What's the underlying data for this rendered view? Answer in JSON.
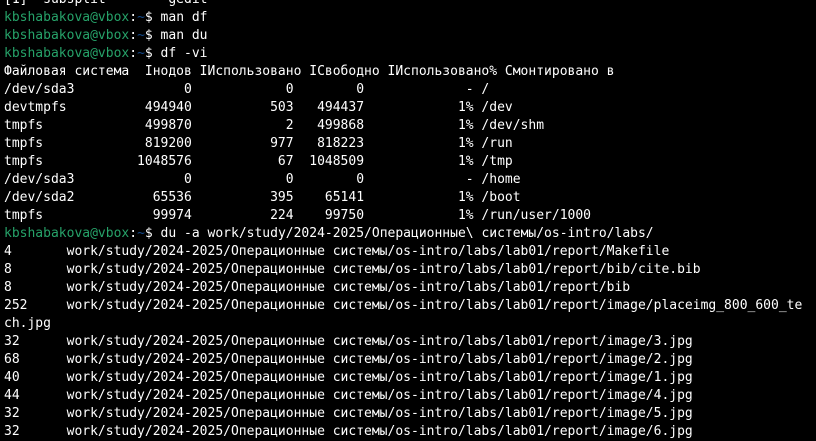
{
  "colors": {
    "background": "#000000",
    "foreground": "#ffffff",
    "prompt_user": "#26a269",
    "prompt_path": "#12488b"
  },
  "prompt": {
    "user_host": "kbshabakova@vbox",
    "colon": ":",
    "path": "~",
    "dollar": "$ "
  },
  "top_partial_line": "[1]  subsplit        gedit",
  "commands": {
    "c1": "man df",
    "c2": "man du",
    "c3": "df -vi",
    "c4": "du -a work/study/2024-2025/Операционные\\ системы/os-intro/labs/"
  },
  "df_output": [
    "Файловая система  Iнодов IИспользовано IСвободно IИспользовано% Смонтировано в",
    "/dev/sda3              0            0        0             - /",
    "devtmpfs          494940          503   494437            1% /dev",
    "tmpfs             499870            2   499868            1% /dev/shm",
    "tmpfs             819200          977   818223            1% /run",
    "tmpfs            1048576           67  1048509            1% /tmp",
    "/dev/sda3              0            0        0             - /home",
    "/dev/sda2          65536          395    65141            1% /boot",
    "tmpfs              99974          224    99750            1% /run/user/1000"
  ],
  "du_output": [
    "4       work/study/2024-2025/Операционные системы/os-intro/labs/lab01/report/Makefile",
    "8       work/study/2024-2025/Операционные системы/os-intro/labs/lab01/report/bib/cite.bib",
    "8       work/study/2024-2025/Операционные системы/os-intro/labs/lab01/report/bib",
    "252     work/study/2024-2025/Операционные системы/os-intro/labs/lab01/report/image/placeimg_800_600_te",
    "ch.jpg",
    "32      work/study/2024-2025/Операционные системы/os-intro/labs/lab01/report/image/3.jpg",
    "68      work/study/2024-2025/Операционные системы/os-intro/labs/lab01/report/image/2.jpg",
    "40      work/study/2024-2025/Операционные системы/os-intro/labs/lab01/report/image/1.jpg",
    "44      work/study/2024-2025/Операционные системы/os-intro/labs/lab01/report/image/4.jpg",
    "32      work/study/2024-2025/Операционные системы/os-intro/labs/lab01/report/image/5.jpg",
    "32      work/study/2024-2025/Операционные системы/os-intro/labs/lab01/report/image/6.jpg"
  ]
}
